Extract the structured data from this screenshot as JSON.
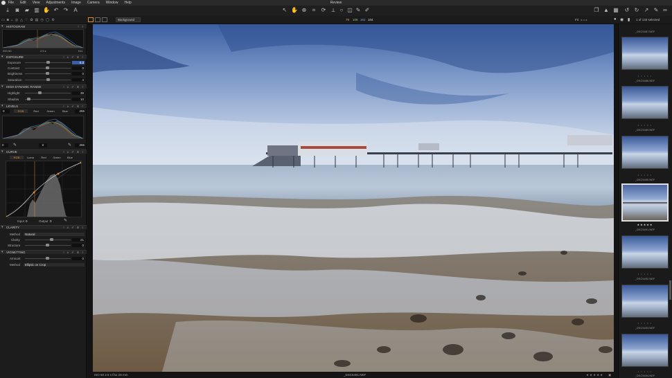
{
  "menu": {
    "items": [
      "File",
      "Edit",
      "View",
      "Adjustments",
      "Image",
      "Camera",
      "Window",
      "Help"
    ],
    "title": "Review"
  },
  "toolbar2": {
    "style_preset": "Background",
    "rgb_values": [
      "79",
      "106",
      "162",
      "104"
    ],
    "fit_label": "Fit",
    "selection": "1 of 133 selected"
  },
  "histogram": {
    "title": "HISTOGRAM",
    "iso": "ISO 50",
    "shutter": "2.5 s",
    "aperture": "f/11"
  },
  "exposure": {
    "title": "EXPOSURE",
    "labels": [
      "Exposure",
      "Contrast",
      "Brightness",
      "Saturation"
    ],
    "values": [
      "0.3",
      "0",
      "0",
      "4"
    ]
  },
  "hdr": {
    "title": "HIGH DYNAMIC RANGE",
    "labels": [
      "Highlight",
      "Shadow"
    ],
    "values": [
      "39",
      "10"
    ]
  },
  "levels": {
    "title": "LEVELS",
    "left": "0",
    "tabs": [
      "RGB",
      "Red",
      "Green",
      "Blue"
    ],
    "right": "255",
    "low": "0",
    "mid": "0",
    "high": "255"
  },
  "curve": {
    "title": "CURVE",
    "tabs": [
      "RGB",
      "Luma",
      "Red",
      "Green",
      "Blue"
    ],
    "input_label": "Input",
    "input_val": "0",
    "output_label": "Output",
    "output_val": "0"
  },
  "clarity": {
    "title": "CLARITY",
    "method_label": "Method",
    "method": "Natural",
    "labels": [
      "Clarity",
      "Structure"
    ],
    "values": [
      "21",
      "0"
    ]
  },
  "vignetting": {
    "title": "VIGNETTING",
    "amount_label": "Amount",
    "amount": "0",
    "method_label": "Method",
    "method": "Elliptic on Crop"
  },
  "status": {
    "left": "ISO 50  2.5 s  f/11  28 mm",
    "filename": "_DSC5491.NEF"
  },
  "thumbs": [
    {
      "name": "_DSC5487.NEF"
    },
    {
      "name": "_DSC5488.NEF"
    },
    {
      "name": "_DSC5489.NEF"
    },
    {
      "name": "_DSC5490.NEF"
    },
    {
      "name": "_DSC5491.NEF"
    },
    {
      "name": "_DSC5492.NEF"
    },
    {
      "name": "_DSC5493.NEF"
    },
    {
      "name": "_DSC5494.NEF"
    }
  ],
  "colors": {
    "accent": "#e08a2a",
    "panel": "#1c1c1c",
    "selection": "#3a5ea8"
  }
}
